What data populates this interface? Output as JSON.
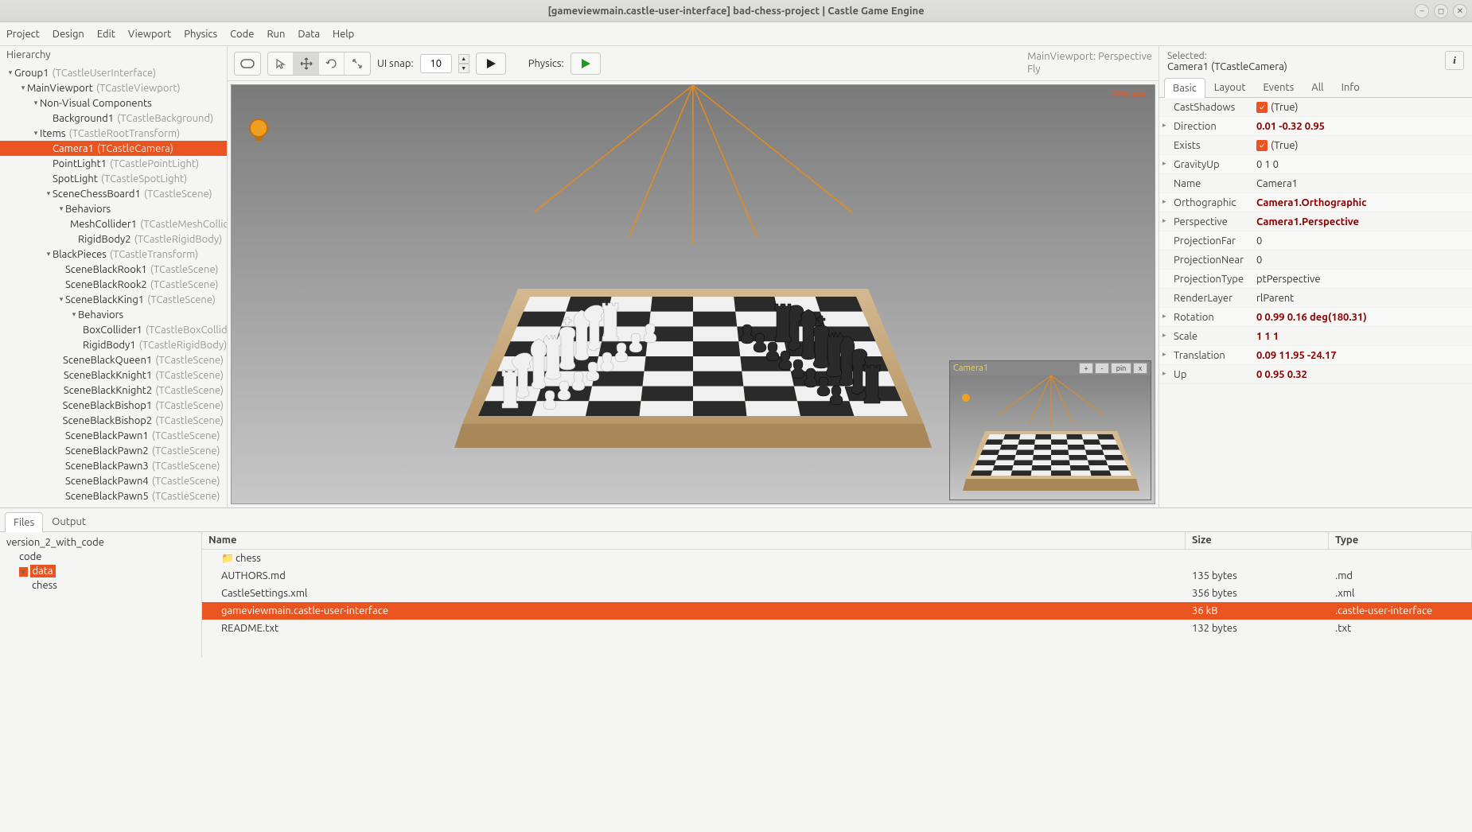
{
  "window": {
    "title": "[gameviewmain.castle-user-interface] bad-chess-project | Castle Game Engine"
  },
  "menubar": [
    "Project",
    "Design",
    "Edit",
    "Viewport",
    "Physics",
    "Code",
    "Run",
    "Data",
    "Help"
  ],
  "hierarchy": {
    "title": "Hierarchy",
    "items": [
      {
        "indent": 0,
        "caret": "▾",
        "name": "Group1",
        "type": "(TCastleUserInterface)",
        "selected": false
      },
      {
        "indent": 1,
        "caret": "▾",
        "name": "MainViewport",
        "type": "(TCastleViewport)",
        "selected": false
      },
      {
        "indent": 2,
        "caret": "▾",
        "name": "Non-Visual Components",
        "type": "",
        "selected": false
      },
      {
        "indent": 3,
        "caret": "",
        "name": "Background1",
        "type": "(TCastleBackground)",
        "selected": false
      },
      {
        "indent": 2,
        "caret": "▾",
        "name": "Items",
        "type": "(TCastleRootTransform)",
        "selected": false
      },
      {
        "indent": 3,
        "caret": "",
        "name": "Camera1",
        "type": "(TCastleCamera)",
        "selected": true
      },
      {
        "indent": 3,
        "caret": "",
        "name": "PointLight1",
        "type": "(TCastlePointLight)",
        "selected": false
      },
      {
        "indent": 3,
        "caret": "",
        "name": "SpotLight",
        "type": "(TCastleSpotLight)",
        "selected": false
      },
      {
        "indent": 3,
        "caret": "▾",
        "name": "SceneChessBoard1",
        "type": "(TCastleScene)",
        "selected": false
      },
      {
        "indent": 4,
        "caret": "▾",
        "name": "Behaviors",
        "type": "",
        "selected": false
      },
      {
        "indent": 5,
        "caret": "",
        "name": "MeshCollider1",
        "type": "(TCastleMeshCollider)",
        "selected": false
      },
      {
        "indent": 5,
        "caret": "",
        "name": "RigidBody2",
        "type": "(TCastleRigidBody)",
        "selected": false
      },
      {
        "indent": 3,
        "caret": "▾",
        "name": "BlackPieces",
        "type": "(TCastleTransform)",
        "selected": false
      },
      {
        "indent": 4,
        "caret": "",
        "name": "SceneBlackRook1",
        "type": "(TCastleScene)",
        "selected": false
      },
      {
        "indent": 4,
        "caret": "",
        "name": "SceneBlackRook2",
        "type": "(TCastleScene)",
        "selected": false
      },
      {
        "indent": 4,
        "caret": "▾",
        "name": "SceneBlackKing1",
        "type": "(TCastleScene)",
        "selected": false
      },
      {
        "indent": 5,
        "caret": "▾",
        "name": "Behaviors",
        "type": "",
        "selected": false
      },
      {
        "indent": 6,
        "caret": "",
        "name": "BoxCollider1",
        "type": "(TCastleBoxCollider)",
        "selected": false
      },
      {
        "indent": 6,
        "caret": "",
        "name": "RigidBody1",
        "type": "(TCastleRigidBody)",
        "selected": false
      },
      {
        "indent": 4,
        "caret": "",
        "name": "SceneBlackQueen1",
        "type": "(TCastleScene)",
        "selected": false
      },
      {
        "indent": 4,
        "caret": "",
        "name": "SceneBlackKnight1",
        "type": "(TCastleScene)",
        "selected": false
      },
      {
        "indent": 4,
        "caret": "",
        "name": "SceneBlackKnight2",
        "type": "(TCastleScene)",
        "selected": false
      },
      {
        "indent": 4,
        "caret": "",
        "name": "SceneBlackBishop1",
        "type": "(TCastleScene)",
        "selected": false
      },
      {
        "indent": 4,
        "caret": "",
        "name": "SceneBlackBishop2",
        "type": "(TCastleScene)",
        "selected": false
      },
      {
        "indent": 4,
        "caret": "",
        "name": "SceneBlackPawn1",
        "type": "(TCastleScene)",
        "selected": false
      },
      {
        "indent": 4,
        "caret": "",
        "name": "SceneBlackPawn2",
        "type": "(TCastleScene)",
        "selected": false
      },
      {
        "indent": 4,
        "caret": "",
        "name": "SceneBlackPawn3",
        "type": "(TCastleScene)",
        "selected": false
      },
      {
        "indent": 4,
        "caret": "",
        "name": "SceneBlackPawn4",
        "type": "(TCastleScene)",
        "selected": false
      },
      {
        "indent": 4,
        "caret": "",
        "name": "SceneBlackPawn5",
        "type": "(TCastleScene)",
        "selected": false
      }
    ]
  },
  "toolbar": {
    "snap_label": "UI snap:",
    "snap_value": "10",
    "physics_label": "Physics:",
    "viewport_info_line1": "MainViewport: Perspective",
    "viewport_info_line2": "Fly"
  },
  "viewport": {
    "fps": "FPS: xxx",
    "camera_preview_title": "Camera1",
    "preview_buttons": [
      "+",
      "-",
      "pin",
      "x"
    ]
  },
  "inspector": {
    "selected_label": "Selected:",
    "selected_name": "Camera1 (TCastleCamera)",
    "tabs": [
      "Basic",
      "Layout",
      "Events",
      "All",
      "Info"
    ],
    "active_tab": "Basic",
    "props": [
      {
        "name": "CastShadows",
        "value": "(True)",
        "bold": false,
        "expandable": false,
        "checkbox": true
      },
      {
        "name": "Direction",
        "value": "0.01 -0.32 0.95",
        "bold": true,
        "expandable": true,
        "checkbox": false
      },
      {
        "name": "Exists",
        "value": "(True)",
        "bold": false,
        "expandable": false,
        "checkbox": true
      },
      {
        "name": "GravityUp",
        "value": "0 1 0",
        "bold": false,
        "expandable": true,
        "checkbox": false
      },
      {
        "name": "Name",
        "value": "Camera1",
        "bold": false,
        "expandable": false,
        "checkbox": false
      },
      {
        "name": "Orthographic",
        "value": "Camera1.Orthographic",
        "bold": true,
        "expandable": true,
        "checkbox": false
      },
      {
        "name": "Perspective",
        "value": "Camera1.Perspective",
        "bold": true,
        "expandable": true,
        "checkbox": false
      },
      {
        "name": "ProjectionFar",
        "value": "0",
        "bold": false,
        "expandable": false,
        "checkbox": false
      },
      {
        "name": "ProjectionNear",
        "value": "0",
        "bold": false,
        "expandable": false,
        "checkbox": false
      },
      {
        "name": "ProjectionType",
        "value": "ptPerspective",
        "bold": false,
        "expandable": false,
        "checkbox": false
      },
      {
        "name": "RenderLayer",
        "value": "rlParent",
        "bold": false,
        "expandable": false,
        "checkbox": false
      },
      {
        "name": "Rotation",
        "value": "0 0.99 0.16 deg(180.31)",
        "bold": true,
        "expandable": true,
        "checkbox": false
      },
      {
        "name": "Scale",
        "value": "1 1 1",
        "bold": true,
        "expandable": true,
        "checkbox": false
      },
      {
        "name": "Translation",
        "value": "0.09 11.95 -24.17",
        "bold": true,
        "expandable": true,
        "checkbox": false
      },
      {
        "name": "Up",
        "value": "0 0.95 0.32",
        "bold": true,
        "expandable": true,
        "checkbox": false
      }
    ]
  },
  "bottom": {
    "tabs": [
      "Files",
      "Output"
    ],
    "active_tab": "Files",
    "folder_tree": [
      {
        "indent": 0,
        "name": "version_2_with_code",
        "selected": false
      },
      {
        "indent": 1,
        "name": "code",
        "selected": false
      },
      {
        "indent": 1,
        "name": "data",
        "selected": true,
        "caret": "▾"
      },
      {
        "indent": 2,
        "name": "chess",
        "selected": false
      }
    ],
    "file_columns": {
      "name": "Name",
      "size": "Size",
      "type": "Type"
    },
    "files": [
      {
        "name": "chess",
        "size": "",
        "type": "",
        "folder": true,
        "selected": false
      },
      {
        "name": "AUTHORS.md",
        "size": "135 bytes",
        "type": ".md",
        "folder": false,
        "selected": false
      },
      {
        "name": "CastleSettings.xml",
        "size": "356 bytes",
        "type": ".xml",
        "folder": false,
        "selected": false
      },
      {
        "name": "gameviewmain.castle-user-interface",
        "size": "36 kB",
        "type": ".castle-user-interface",
        "folder": false,
        "selected": true
      },
      {
        "name": "README.txt",
        "size": "132 bytes",
        "type": ".txt",
        "folder": false,
        "selected": false
      }
    ]
  }
}
